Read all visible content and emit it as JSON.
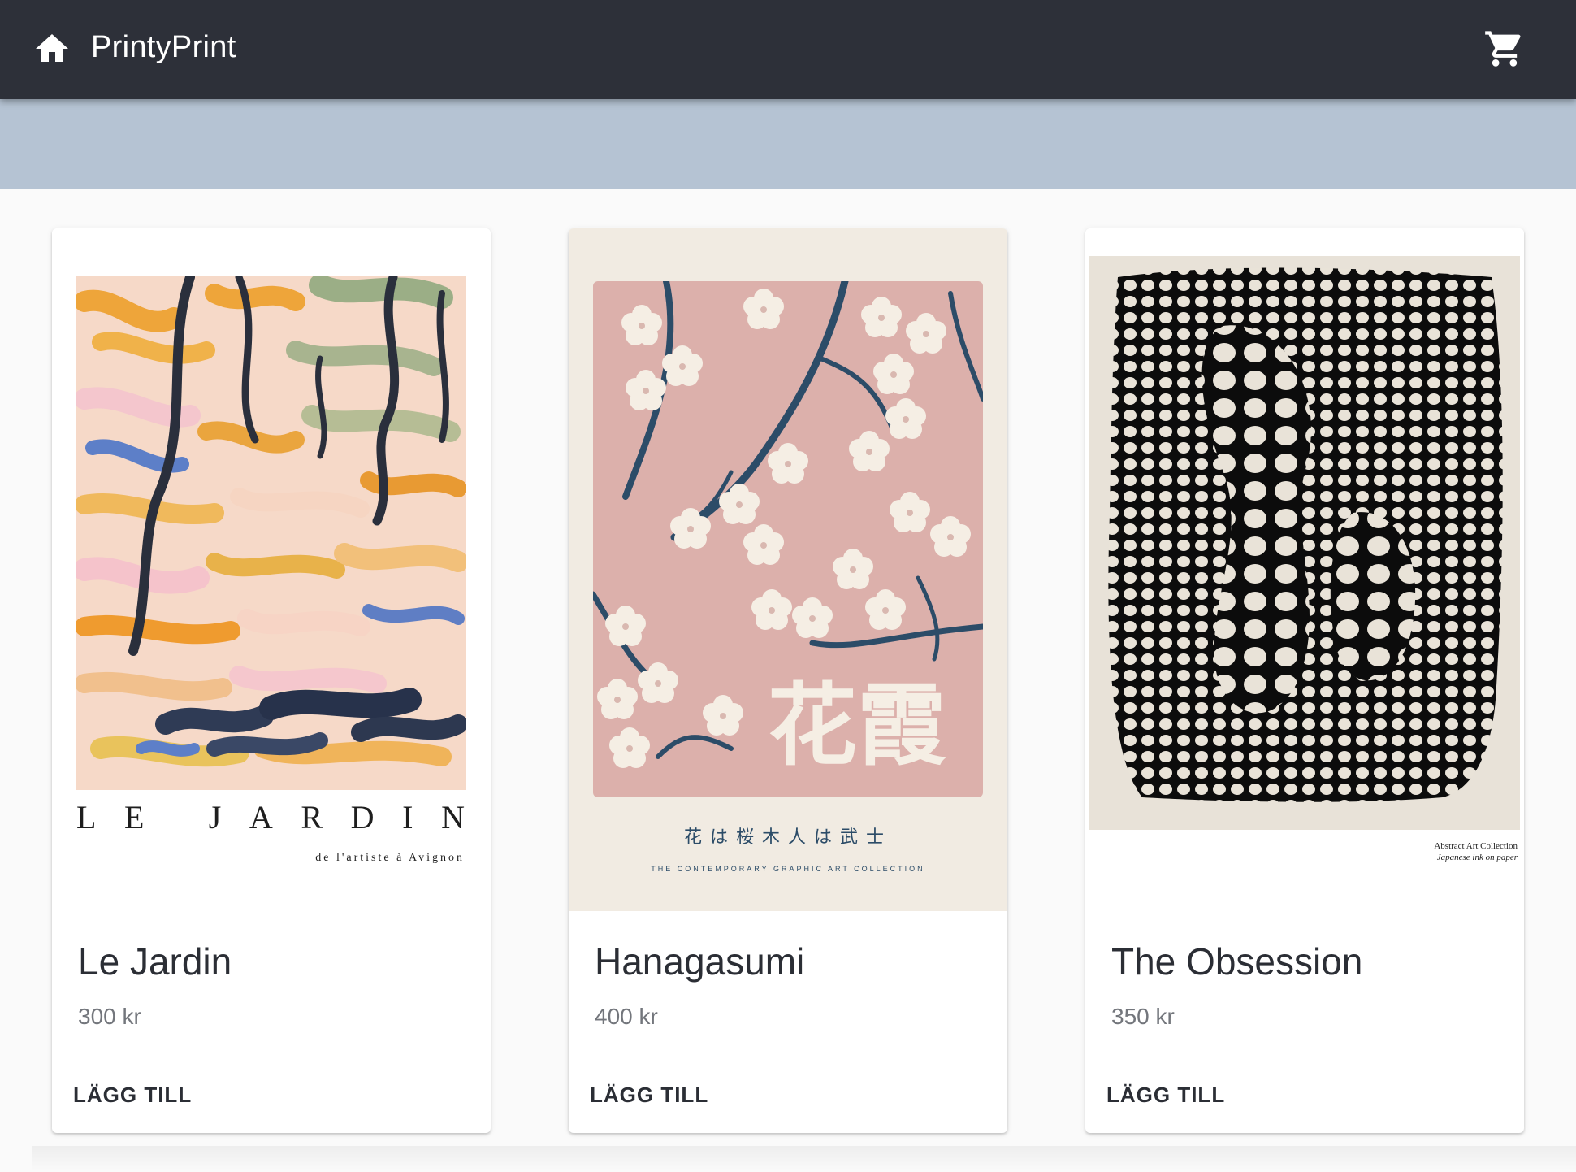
{
  "appbar": {
    "title": "PrintyPrint",
    "home_icon": "home-icon",
    "cart_icon": "shopping-cart-icon",
    "background": "#2d3039"
  },
  "hero": {
    "background": "#b5c3d3"
  },
  "products": [
    {
      "name": "Le Jardin",
      "price": "300 kr",
      "button": "LÄGG TILL",
      "poster_text": {
        "main": "LE JARDIN",
        "sub": "de l'artiste à Avignon"
      }
    },
    {
      "name": "Hanagasumi",
      "price": "400 kr",
      "button": "LÄGG TILL",
      "poster_text": {
        "kanji": "花霞",
        "line": "花は桜木人は武士",
        "sub": "THE CONTEMPORARY GRAPHIC ART COLLECTION"
      }
    },
    {
      "name": "The Obsession",
      "price": "350 kr",
      "button": "LÄGG TILL",
      "poster_text": {
        "line1": "Abstract Art Collection",
        "line2": "Japanese ink on paper"
      }
    }
  ],
  "colors": {
    "accent_text": "#2b2e35",
    "price_text": "#73767c"
  }
}
